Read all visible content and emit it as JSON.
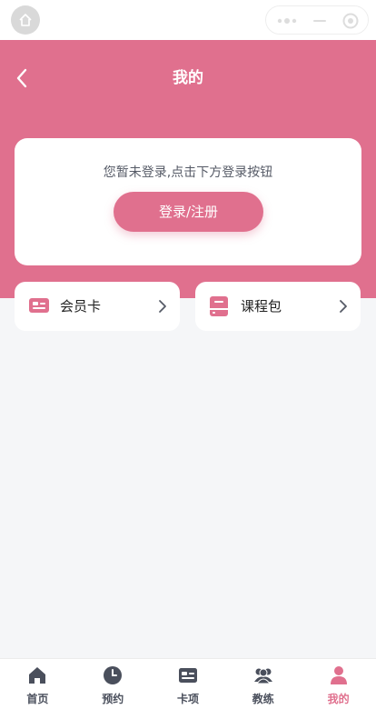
{
  "header": {
    "title": "我的",
    "bg_color": "#e0708e"
  },
  "login_card": {
    "tip": "您暂未登录,点击下方登录按钮",
    "button_label": "登录/注册"
  },
  "entries": [
    {
      "label": "会员卡",
      "icon": "member-card-icon"
    },
    {
      "label": "课程包",
      "icon": "course-package-icon"
    }
  ],
  "tabs": [
    {
      "label": "首页",
      "icon": "home-icon",
      "active": false
    },
    {
      "label": "预约",
      "icon": "clock-icon",
      "active": false
    },
    {
      "label": "卡项",
      "icon": "card-icon",
      "active": false
    },
    {
      "label": "教练",
      "icon": "coach-icon",
      "active": false
    },
    {
      "label": "我的",
      "icon": "user-icon",
      "active": true
    }
  ],
  "colors": {
    "accent": "#e0708e",
    "tab_inactive": "#4a4f5c",
    "page_bg": "#f5f6f8"
  }
}
